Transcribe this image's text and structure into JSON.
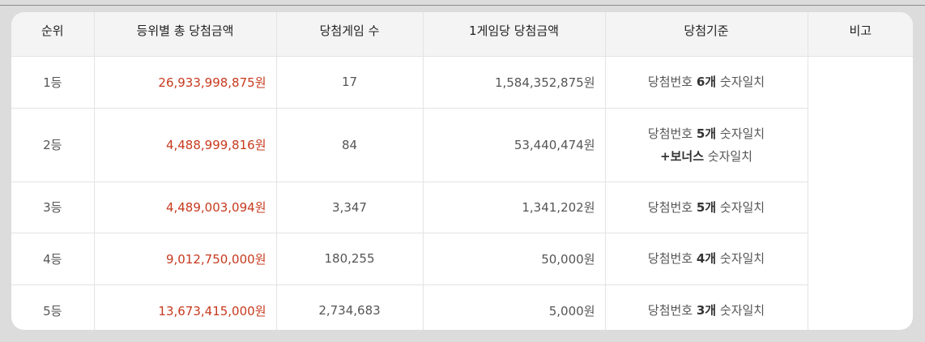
{
  "table": {
    "headers": {
      "rank": "순위",
      "total_prize": "등위별 총 당첨금액",
      "winners": "당첨게임 수",
      "per_game": "1게임당 당첨금액",
      "criteria": "당첨기준",
      "note": "비고"
    },
    "rows": [
      {
        "rank": "1등",
        "total_prize": "26,933,998,875원",
        "winners": "17",
        "per_game": "1,584,352,875원",
        "criteria": {
          "prefix": "당첨번호 ",
          "count": "6개",
          "suffix": " 숫자일치"
        }
      },
      {
        "rank": "2등",
        "total_prize": "4,488,999,816원",
        "winners": "84",
        "per_game": "53,440,474원",
        "criteria": {
          "prefix": "당첨번호 ",
          "count": "5개",
          "suffix": " 숫자일치"
        },
        "criteria_extra": {
          "bonus": "+보너스",
          "suffix": " 숫자일치"
        }
      },
      {
        "rank": "3등",
        "total_prize": "4,489,003,094원",
        "winners": "3,347",
        "per_game": "1,341,202원",
        "criteria": {
          "prefix": "당첨번호 ",
          "count": "5개",
          "suffix": " 숫자일치"
        }
      },
      {
        "rank": "4등",
        "total_prize": "9,012,750,000원",
        "winners": "180,255",
        "per_game": "50,000원",
        "criteria": {
          "prefix": "당첨번호 ",
          "count": "4개",
          "suffix": " 숫자일치"
        }
      },
      {
        "rank": "5등",
        "total_prize": "13,673,415,000원",
        "winners": "2,734,683",
        "per_game": "5,000원",
        "criteria": {
          "prefix": "당첨번호 ",
          "count": "3개",
          "suffix": " 숫자일치"
        }
      }
    ]
  },
  "colors": {
    "prize_red": "#c7391d",
    "header_bg": "#f4f4f4",
    "page_bg": "#dcdcdc"
  }
}
